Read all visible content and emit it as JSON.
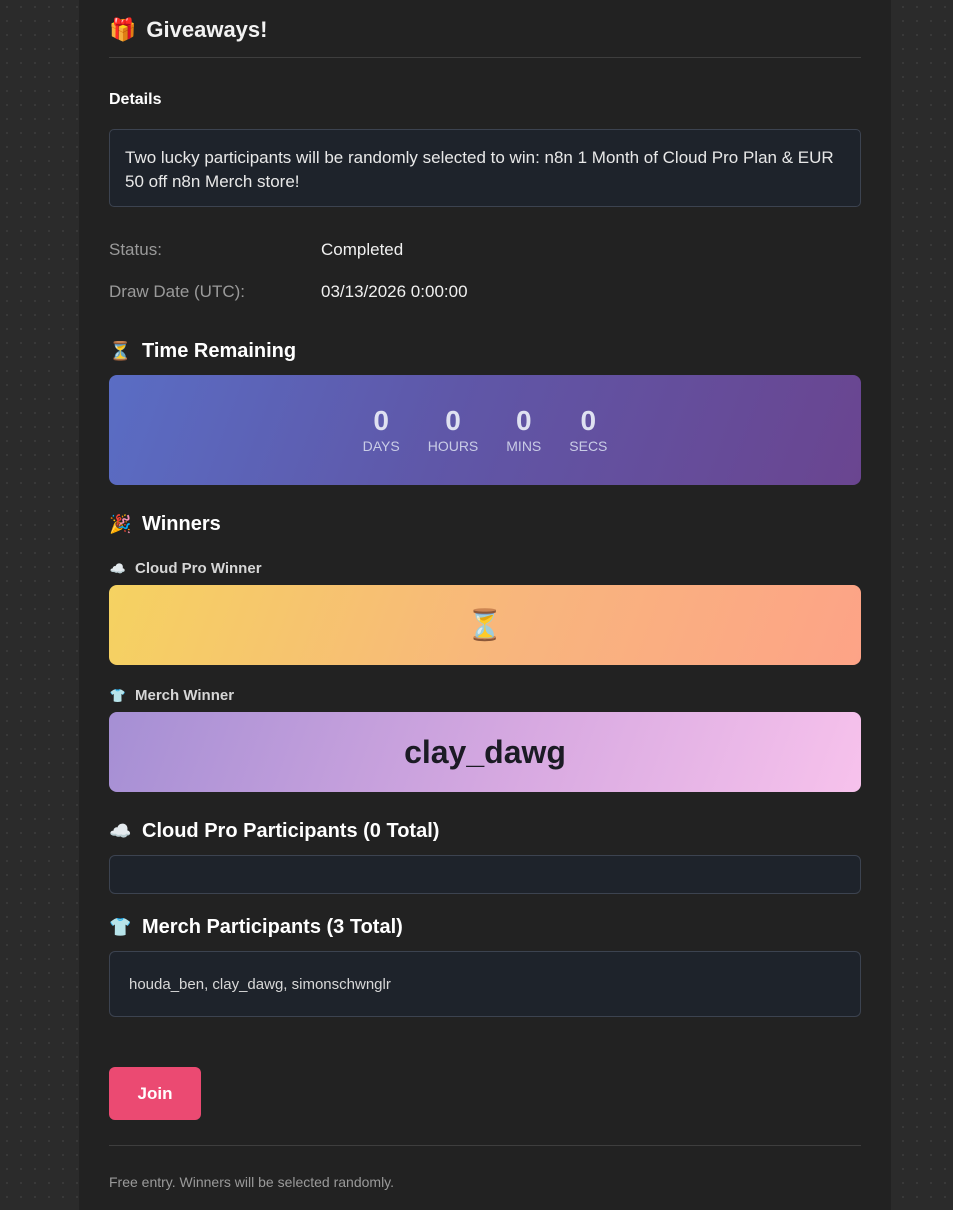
{
  "header": {
    "icon": "gift-icon",
    "emoji": "🎁",
    "title": "Giveaways!"
  },
  "details": {
    "label": "Details",
    "text": "Two lucky participants will be randomly selected to win: n8n 1 Month of Cloud Pro Plan & EUR 50 off n8n Merch store!"
  },
  "info": {
    "status_label": "Status:",
    "status_value": "Completed",
    "draw_label": "Draw Date (UTC):",
    "draw_value": "03/13/2026 0:00:00"
  },
  "time_remaining": {
    "icon": "hourglass-icon",
    "emoji": "⏳",
    "title": "Time Remaining",
    "units": [
      {
        "value": "0",
        "label": "DAYS"
      },
      {
        "value": "0",
        "label": "HOURS"
      },
      {
        "value": "0",
        "label": "MINS"
      },
      {
        "value": "0",
        "label": "SECS"
      }
    ]
  },
  "winners": {
    "icon": "party-popper-icon",
    "emoji": "🎉",
    "title": "Winners",
    "cloud": {
      "icon": "cloud-icon",
      "emoji": "☁️",
      "label": "Cloud Pro Winner",
      "value_icon": "hourglass-icon",
      "value_emoji": "⏳"
    },
    "merch": {
      "icon": "tshirt-icon",
      "emoji": "👕",
      "label": "Merch Winner",
      "value": "clay_dawg"
    }
  },
  "cloud_participants": {
    "icon": "cloud-icon",
    "emoji": "☁️",
    "title": "Cloud Pro Participants (0 Total)",
    "list": ""
  },
  "merch_participants": {
    "icon": "tshirt-icon",
    "emoji": "👕",
    "title": "Merch Participants (3 Total)",
    "list": "houda_ben, clay_dawg, simonschwnglr"
  },
  "join_button": {
    "label": "Join"
  },
  "footer": {
    "text": "Free entry. Winners will be selected randomly."
  },
  "colors": {
    "join_button": "#eb4a72",
    "timer_gradient": [
      "#5a6dc4",
      "#6a4590"
    ],
    "cloud_winner_gradient": [
      "#f5d261",
      "#fda387"
    ],
    "merch_winner_gradient": [
      "#a58fd4",
      "#f7c2ec"
    ]
  }
}
